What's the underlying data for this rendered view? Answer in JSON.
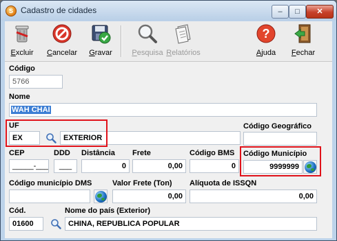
{
  "window": {
    "title": "Cadastro de cidades"
  },
  "toolbar": {
    "excluir": "Excluir",
    "cancelar": "Cancelar",
    "gravar": "Gravar",
    "pesquisa": "Pesquisa",
    "relatorios": "Relatórios",
    "ajuda": "Ajuda",
    "fechar": "Fechar"
  },
  "form": {
    "codigo": {
      "label": "Código",
      "value": "5766"
    },
    "nome": {
      "label": "Nome",
      "value": "WAH CHAI"
    },
    "uf": {
      "label": "UF",
      "value": "EX",
      "description": "EXTERIOR"
    },
    "codigo_geografico": {
      "label": "Código Geográfico",
      "value": ""
    },
    "cep": {
      "label": "CEP",
      "value": "_____-___"
    },
    "ddd": {
      "label": "DDD",
      "value": "___"
    },
    "distancia": {
      "label": "Distância",
      "value": "0"
    },
    "frete": {
      "label": "Frete",
      "value": "0,00"
    },
    "codigo_bms": {
      "label": "Código BMS",
      "value": "0"
    },
    "codigo_municipio": {
      "label": "Código Município",
      "value": "9999999"
    },
    "codigo_municipio_dms": {
      "label": "Código município DMS",
      "value": ""
    },
    "valor_frete_ton": {
      "label": "Valor Frete (Ton)",
      "value": "0,00"
    },
    "aliquota_issqn": {
      "label": "Alíquota de ISSQN",
      "value": "0,00"
    },
    "cod_pais": {
      "label": "Cód.",
      "value": "01600"
    },
    "nome_pais": {
      "label": "Nome do país (Exterior)",
      "value": "CHINA, REPUBLICA POPULAR"
    }
  }
}
